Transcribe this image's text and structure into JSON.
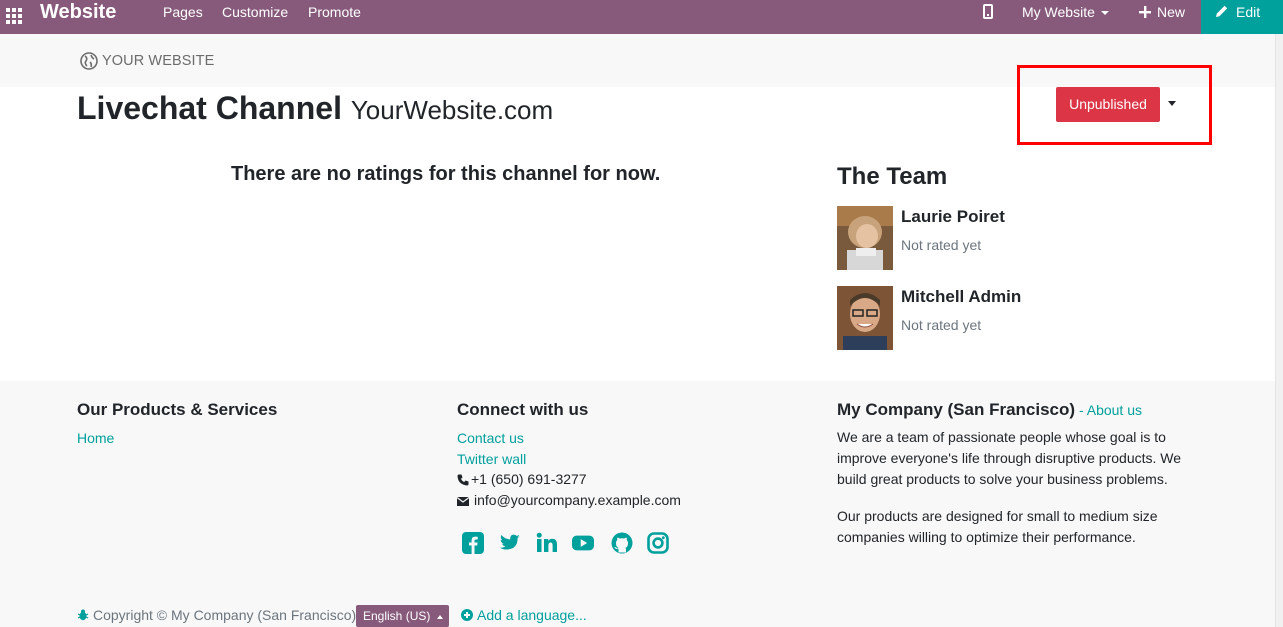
{
  "topbar": {
    "brand": "Website",
    "menu": [
      "Pages",
      "Customize",
      "Promote"
    ],
    "my_website": "My Website",
    "new_label": "New",
    "edit_label": "Edit"
  },
  "header": {
    "logo_text": "YOUR WEBSITE"
  },
  "page": {
    "title": "Livechat Channel",
    "subtitle": "YourWebsite.com",
    "publish_button": "Unpublished",
    "no_ratings": "There are no ratings for this channel for now."
  },
  "team": {
    "title": "The Team",
    "members": [
      {
        "name": "Laurie Poiret",
        "status": "Not rated yet"
      },
      {
        "name": "Mitchell Admin",
        "status": "Not rated yet"
      }
    ]
  },
  "footer": {
    "products_title": "Our Products & Services",
    "products_links": [
      "Home"
    ],
    "connect_title": "Connect with us",
    "connect_links": [
      "Contact us",
      "Twitter wall"
    ],
    "phone": "+1 (650) 691-3277",
    "email": "info@yourcompany.example.com",
    "social": [
      "facebook-icon",
      "twitter-icon",
      "linkedin-icon",
      "youtube-icon",
      "github-icon",
      "instagram-icon"
    ],
    "company_title": "My Company (San Francisco)",
    "about_sep": " - ",
    "about_link": "About us",
    "about_text_1": "We are a team of passionate people whose goal is to improve everyone's life through disruptive products. We build great products to solve your business problems.",
    "about_text_2": "Our products are designed for small to medium size companies willing to optimize their performance.",
    "copyright": "Copyright © My Company (San Francisco)",
    "language": "English (US)",
    "add_language": "Add a language..."
  },
  "colors": {
    "navbar": "#875a7b",
    "accent": "#00a09d",
    "danger": "#dc3545",
    "highlight": "#ff0000"
  }
}
